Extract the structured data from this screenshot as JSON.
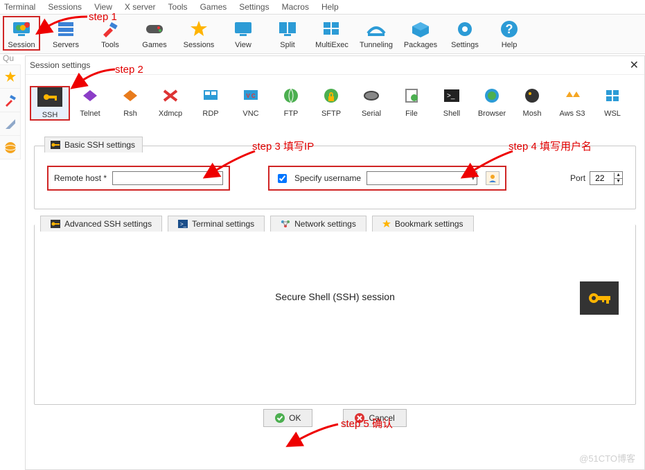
{
  "menubar": [
    "Terminal",
    "Sessions",
    "View",
    "X server",
    "Tools",
    "Games",
    "Settings",
    "Macros",
    "Help"
  ],
  "toolbar": [
    {
      "label": "Session",
      "icon": "monitor-new",
      "hl": true
    },
    {
      "label": "Servers",
      "icon": "servers"
    },
    {
      "label": "Tools",
      "icon": "tools"
    },
    {
      "label": "Games",
      "icon": "gamepad"
    },
    {
      "label": "Sessions",
      "icon": "star"
    },
    {
      "label": "View",
      "icon": "monitor"
    },
    {
      "label": "Split",
      "icon": "split"
    },
    {
      "label": "MultiExec",
      "icon": "multiexec"
    },
    {
      "label": "Tunneling",
      "icon": "tunnel"
    },
    {
      "label": "Packages",
      "icon": "packages"
    },
    {
      "label": "Settings",
      "icon": "gear"
    },
    {
      "label": "Help",
      "icon": "help"
    }
  ],
  "quick": "Qu",
  "sidetabs": [
    "star",
    "tools-mini",
    "plane",
    "globe"
  ],
  "dialog": {
    "title": "Session settings",
    "types": [
      {
        "label": "SSH",
        "icon": "key",
        "hl": true
      },
      {
        "label": "Telnet",
        "icon": "telnet"
      },
      {
        "label": "Rsh",
        "icon": "rsh"
      },
      {
        "label": "Xdmcp",
        "icon": "xdmcp"
      },
      {
        "label": "RDP",
        "icon": "rdp"
      },
      {
        "label": "VNC",
        "icon": "vnc"
      },
      {
        "label": "FTP",
        "icon": "ftp"
      },
      {
        "label": "SFTP",
        "icon": "sftp"
      },
      {
        "label": "Serial",
        "icon": "serial"
      },
      {
        "label": "File",
        "icon": "file"
      },
      {
        "label": "Shell",
        "icon": "shell"
      },
      {
        "label": "Browser",
        "icon": "browser"
      },
      {
        "label": "Mosh",
        "icon": "mosh"
      },
      {
        "label": "Aws S3",
        "icon": "aws"
      },
      {
        "label": "WSL",
        "icon": "wsl"
      }
    ],
    "basic": {
      "legend": "Basic SSH settings",
      "remote_label": "Remote host *",
      "remote_value": "",
      "specify_label": "Specify username",
      "specify_checked": true,
      "username_value": "",
      "port_label": "Port",
      "port_value": "22"
    },
    "adv_tabs": [
      {
        "icon": "key-mini",
        "label": "Advanced SSH settings"
      },
      {
        "icon": "term-mini",
        "label": "Terminal settings"
      },
      {
        "icon": "net-mini",
        "label": "Network settings"
      },
      {
        "icon": "star-mini",
        "label": "Bookmark settings"
      }
    ],
    "center_text": "Secure Shell (SSH) session",
    "ok": "OK",
    "cancel": "Cancel"
  },
  "annotations": {
    "s1": "step 1",
    "s2": "step 2",
    "s3": "step 3 填写IP",
    "s4": "step 4 填写用户名",
    "s5": "step 5 确认"
  },
  "watermark": "@51CTO博客"
}
